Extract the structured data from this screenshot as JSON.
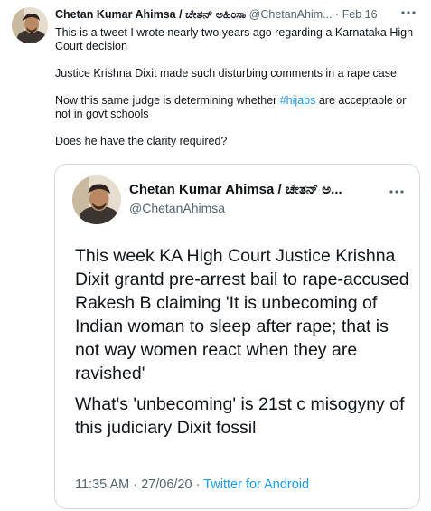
{
  "tweet": {
    "author_name": "Chetan Kumar Ahimsa / ಚೇತನ್ ಅಹಿಂಸಾ",
    "handle": "@ChetanAhim...",
    "separator": "·",
    "date": "Feb 16",
    "lines": {
      "p1": "This is a tweet I wrote nearly two years ago regarding a Karnataka High Court decision",
      "p2": "Justice Krishna Dixit made such disturbing comments in a rape case",
      "p3_before": "Now this same judge is determining whether ",
      "p3_hashtag": "#hijabs",
      "p3_after": " are acceptable or not in govt schools",
      "p4": "Does he have the clarity required?"
    },
    "more_icon": "more-horizontal-icon"
  },
  "quoted_tweet": {
    "author_name": "Chetan Kumar Ahimsa / ಚೇತನ್ ಅ...",
    "handle": "@ChetanAhimsa",
    "text_p1": "This week KA High Court Justice Krishna Dixit grantd pre-arrest bail to rape-accused Rakesh B claiming 'It is unbecoming of Indian woman to sleep after rape; that is not way women react when they are ravished'",
    "text_p2": "What's 'unbecoming' is 21st c misogyny of this judiciary Dixit fossil",
    "time": "11:35 AM",
    "separator": "·",
    "date": "27/06/20",
    "source_separator": "·",
    "source": "Twitter for Android",
    "more_icon": "more-horizontal-icon"
  },
  "colors": {
    "text": "#0f1419",
    "secondary": "#536471",
    "link": "#1d9bf0",
    "border": "#cfd9de"
  }
}
